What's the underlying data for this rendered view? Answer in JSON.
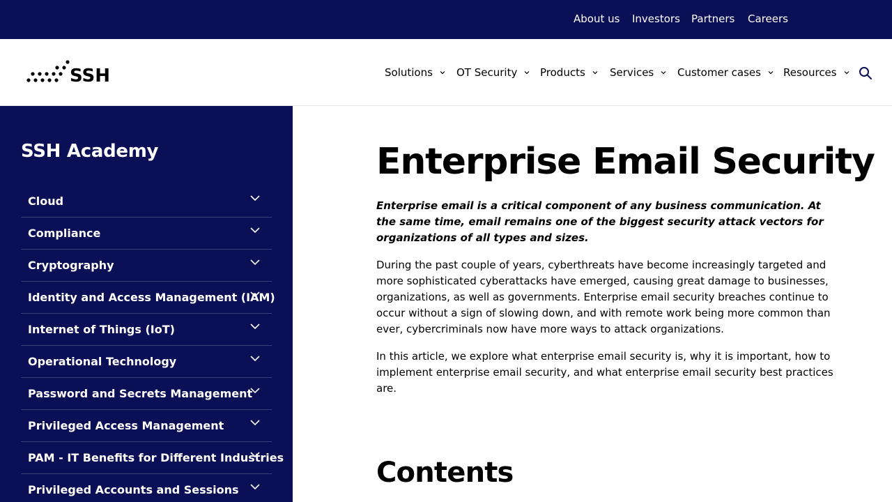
{
  "topbar": {
    "links": [
      "About us",
      "Investors",
      "Partners",
      "Careers"
    ]
  },
  "brand": {
    "name": "SSH"
  },
  "nav": {
    "items": [
      "Solutions",
      "OT Security",
      "Products",
      "Services",
      "Customer cases",
      "Resources"
    ]
  },
  "icons": {
    "search": "search-icon",
    "chevron": "chevron-down-icon",
    "logo": "ssh-logo-dots"
  },
  "colors": {
    "navy": "#0a0f56",
    "white": "#ffffff"
  },
  "sidebar": {
    "title": "SSH Academy",
    "items": [
      "Cloud",
      "Compliance",
      "Cryptography",
      "Identity and Access Management (IAM)",
      "Internet of Things (IoT)",
      "Operational Technology",
      "Password and Secrets Management",
      "Privileged Access Management",
      "PAM - IT Benefits for Different Industries",
      "Privileged Accounts and Sessions"
    ]
  },
  "article": {
    "title": "Enterprise Email Security",
    "lead": "Enterprise email is a critical component of any business communication. At the same time, email remains one of the biggest security attack vectors for organizations of all types and sizes.",
    "paragraphs": [
      "During the past couple of years, cyberthreats have become increasingly targeted and more sophisticated cyberattacks have emerged, causing great damage to businesses, organizations, as well as governments. Enterprise email security breaches continue to occur without a sign of slowing down, and with remote work being more common than ever, cybercriminals now have more ways to attack organizations.",
      "In this article, we explore what enterprise email security is, why it is important, how to implement enterprise email security, and what enterprise email security best practices are."
    ],
    "contents_heading": "Contents"
  }
}
